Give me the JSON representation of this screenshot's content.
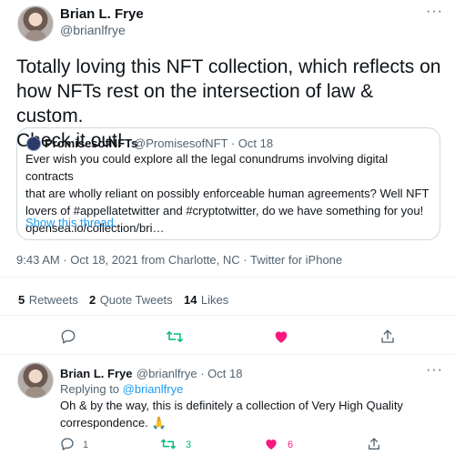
{
  "colors": {
    "accent": "#1d9bf0",
    "retweet": "#00ba7c",
    "like": "#f91880",
    "muted": "#536471",
    "border": "#cfd9de"
  },
  "tweet": {
    "author_name": "Brian L. Frye",
    "author_handle": "@brianlfrye",
    "more": "···",
    "text_line1": "Totally loving this NFT collection, which reflects on",
    "text_line2": "how NFTs rest on the intersection of law & custom.",
    "text_line3": "Check it out!",
    "timestamp": "9:43 AM · Oct 18, 2021 from Charlotte, NC · Twitter for iPhone"
  },
  "quote": {
    "name": "PromisesofNFTs",
    "handle_date": "@PromisesofNFT · Oct 18",
    "line1": "Ever wish you could explore all the legal conundrums involving digital contracts",
    "line2": "that are wholly reliant on possibly enforceable human agreements? Well NFT",
    "line3": "lovers of #appellatetwitter and #cryptotwitter, do we have something for you!",
    "line4": "opensea.io/collection/bri…",
    "show_thread": "Show this thread"
  },
  "stats": {
    "retweets_count": "5",
    "retweets_label": "Retweets",
    "quotes_count": "2",
    "quotes_label": "Quote Tweets",
    "likes_count": "14",
    "likes_label": "Likes"
  },
  "actions": {
    "icons": [
      "reply-icon",
      "retweet-icon",
      "like-icon",
      "share-icon"
    ]
  },
  "reply": {
    "name": "Brian L. Frye",
    "handle_date": "@brianlfrye · Oct 18",
    "more": "···",
    "replying_prefix": "Replying to ",
    "replying_handle": "@brianlfrye",
    "line1": "Oh & by the way, this is definitely a collection of Very High Quality",
    "line2": "correspondence. 🙏",
    "reply_count": "1",
    "retweet_count": "3",
    "like_count": "6"
  }
}
